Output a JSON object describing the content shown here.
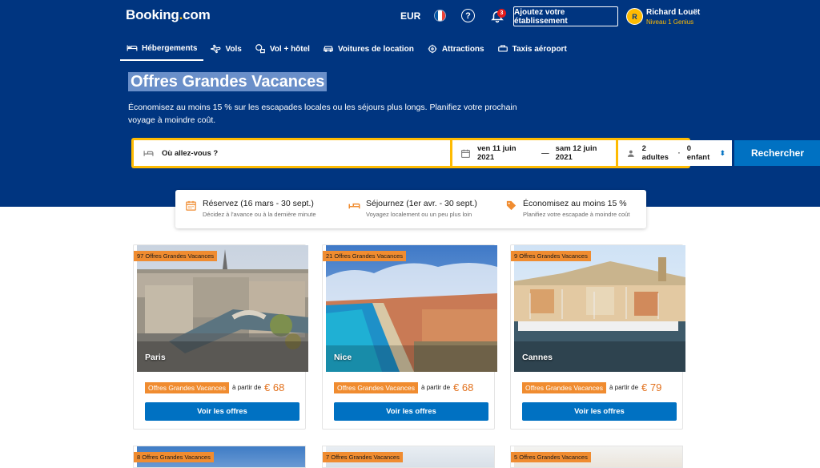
{
  "header": {
    "logo_main": "Booking",
    "logo_dot": ".",
    "logo_com": "com",
    "currency": "EUR",
    "help_glyph": "?",
    "notifications_count": "3",
    "list_property_label": "Ajoutez votre établissement",
    "avatar_initial": "R",
    "user_name": "Richard Louët",
    "user_level": "Niveau 1 Genius"
  },
  "nav": {
    "items": [
      {
        "label": "Hébergements",
        "icon": "bed-icon"
      },
      {
        "label": "Vols",
        "icon": "plane-icon"
      },
      {
        "label": "Vol + hôtel",
        "icon": "plane-hotel-icon"
      },
      {
        "label": "Voitures de location",
        "icon": "car-icon"
      },
      {
        "label": "Attractions",
        "icon": "attraction-icon"
      },
      {
        "label": "Taxis aéroport",
        "icon": "taxi-icon"
      }
    ]
  },
  "hero": {
    "title": "Offres Grandes Vacances",
    "subtitle": "Économisez au moins 15 % sur les escapades locales ou les séjours plus longs. Planifiez votre prochain voyage à moindre coût."
  },
  "search": {
    "destination_placeholder": "Où allez-vous ?",
    "checkin": "ven 11 juin 2021",
    "date_sep": "—",
    "checkout": "sam 12 juin 2021",
    "adults": "2 adultes",
    "guests_sep": "·",
    "children": "0 enfant",
    "button": "Rechercher"
  },
  "info": [
    {
      "title": "Réservez (16 mars - 30 sept.)",
      "desc": "Décidez à l'avance ou à la dernière minute",
      "icon": "calendar-icon"
    },
    {
      "title": "Séjournez (1er avr. - 30 sept.)",
      "desc": "Voyagez localement ou un peu plus loin",
      "icon": "bed-icon"
    },
    {
      "title": "Économisez au moins 15 %",
      "desc": "Planifiez votre escapade à moindre coût",
      "icon": "price-tag-icon"
    }
  ],
  "cards": [
    {
      "badge": "97 Offres Grandes Vacances",
      "city": "Paris",
      "deal": "Offres Grandes Vacances",
      "from": "à partir de",
      "price": "€ 68",
      "button": "Voir les offres"
    },
    {
      "badge": "21 Offres Grandes Vacances",
      "city": "Nice",
      "deal": "Offres Grandes Vacances",
      "from": "à partir de",
      "price": "€ 68",
      "button": "Voir les offres"
    },
    {
      "badge": "9 Offres Grandes Vacances",
      "city": "Cannes",
      "deal": "Offres Grandes Vacances",
      "from": "à partir de",
      "price": "€ 79",
      "button": "Voir les offres"
    }
  ],
  "cards_row2": [
    {
      "badge": "8 Offres Grandes Vacances"
    },
    {
      "badge": "7 Offres Grandes Vacances"
    },
    {
      "badge": "5 Offres Grandes Vacances"
    }
  ],
  "colors": {
    "brand_blue": "#003580",
    "accent_yellow": "#febb02",
    "button_blue": "#0071c2",
    "deal_orange": "#f08c30"
  }
}
